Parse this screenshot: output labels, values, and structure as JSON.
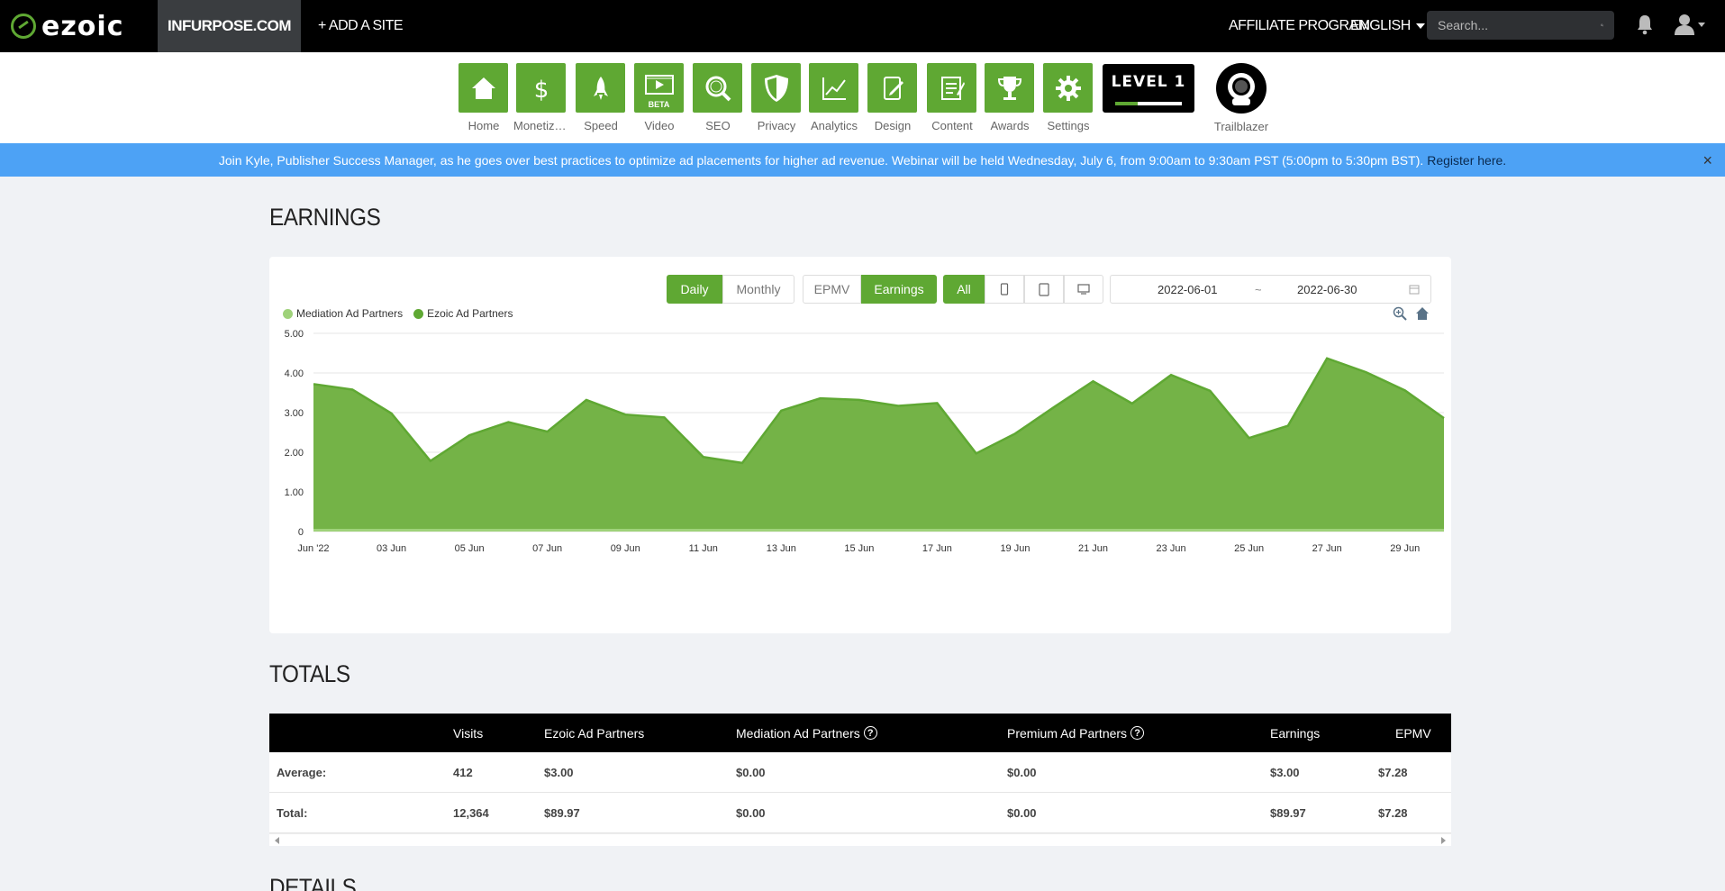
{
  "topbar": {
    "logo": "ezoic",
    "site": "INFURPOSE.COM",
    "add_site": "+ ADD A SITE",
    "affiliate": "AFFILIATE PROGRAM",
    "language": "ENGLISH",
    "search_placeholder": "Search..."
  },
  "nav": {
    "items": [
      {
        "label": "Home",
        "icon": "home-icon"
      },
      {
        "label": "Monetiza...",
        "icon": "dollar-icon"
      },
      {
        "label": "Speed",
        "icon": "rocket-icon"
      },
      {
        "label": "Video",
        "icon": "video-icon",
        "badge": "BETA"
      },
      {
        "label": "SEO",
        "icon": "magnifier-icon"
      },
      {
        "label": "Privacy",
        "icon": "shield-icon"
      },
      {
        "label": "Analytics",
        "icon": "chart-line-icon"
      },
      {
        "label": "Design",
        "icon": "design-icon"
      },
      {
        "label": "Content",
        "icon": "content-icon"
      },
      {
        "label": "Awards",
        "icon": "trophy-icon"
      },
      {
        "label": "Settings",
        "icon": "gear-icon"
      }
    ],
    "level": "LEVEL 1",
    "level_progress": 0.34,
    "trailblazer": "Trailblazer"
  },
  "banner": {
    "text": "Join Kyle, Publisher Success Manager, as he goes over best practices to optimize ad placements for higher ad revenue. Webinar will be held Wednesday, July 6, from 9:00am to 9:30am PST (5:00pm to 5:30pm BST).",
    "link": "Register here.",
    "close": "×"
  },
  "earnings": {
    "title": "EARNINGS",
    "period_buttons": [
      "Daily",
      "Monthly"
    ],
    "metric_buttons": [
      "EPMV",
      "Earnings"
    ],
    "device_all": "All",
    "date_start": "2022-06-01",
    "date_sep": "~",
    "date_end": "2022-06-30"
  },
  "chart_data": {
    "type": "area",
    "legend": [
      "Mediation Ad Partners",
      "Ezoic Ad Partners"
    ],
    "colors": {
      "mediation": "#9fd27a",
      "ezoic": "#5fa833",
      "fill": "#74b347"
    },
    "y_ticks": [
      "0",
      "1.00",
      "2.00",
      "3.00",
      "4.00",
      "5.00"
    ],
    "ylim": [
      0,
      5
    ],
    "x_tick_labels": [
      "Jun '22",
      "03 Jun",
      "05 Jun",
      "07 Jun",
      "09 Jun",
      "11 Jun",
      "13 Jun",
      "15 Jun",
      "17 Jun",
      "19 Jun",
      "21 Jun",
      "23 Jun",
      "25 Jun",
      "27 Jun",
      "29 Jun"
    ],
    "x": [
      "2022-06-01",
      "2022-06-02",
      "2022-06-03",
      "2022-06-04",
      "2022-06-05",
      "2022-06-06",
      "2022-06-07",
      "2022-06-08",
      "2022-06-09",
      "2022-06-10",
      "2022-06-11",
      "2022-06-12",
      "2022-06-13",
      "2022-06-14",
      "2022-06-15",
      "2022-06-16",
      "2022-06-17",
      "2022-06-18",
      "2022-06-19",
      "2022-06-20",
      "2022-06-21",
      "2022-06-22",
      "2022-06-23",
      "2022-06-24",
      "2022-06-25",
      "2022-06-26",
      "2022-06-27",
      "2022-06-28",
      "2022-06-29",
      "2022-06-30"
    ],
    "series": [
      {
        "name": "Mediation Ad Partners",
        "values": [
          0,
          0,
          0,
          0,
          0,
          0,
          0,
          0,
          0,
          0,
          0,
          0,
          0,
          0,
          0,
          0,
          0,
          0,
          0,
          0,
          0,
          0,
          0,
          0,
          0,
          0,
          0,
          0,
          0,
          0
        ]
      },
      {
        "name": "Ezoic Ad Partners",
        "values": [
          3.72,
          3.58,
          2.98,
          1.78,
          2.43,
          2.76,
          2.52,
          3.32,
          2.95,
          2.88,
          1.88,
          1.73,
          3.05,
          3.36,
          3.32,
          3.17,
          3.24,
          1.97,
          2.47,
          3.14,
          3.79,
          3.23,
          3.95,
          3.55,
          2.36,
          2.67,
          4.37,
          4.02,
          3.56,
          2.86
        ]
      }
    ]
  },
  "totals": {
    "title": "TOTALS",
    "headers": [
      "Visits",
      "Ezoic Ad Partners",
      "Mediation Ad Partners",
      "Premium Ad Partners",
      "Earnings",
      "EPMV"
    ],
    "rows": [
      {
        "label": "Average:",
        "cells": [
          "412",
          "$3.00",
          "$0.00",
          "$0.00",
          "$3.00",
          "$7.28"
        ]
      },
      {
        "label": "Total:",
        "cells": [
          "12,364",
          "$89.97",
          "$0.00",
          "$0.00",
          "$89.97",
          "$7.28"
        ]
      }
    ]
  },
  "details": {
    "title": "DETAILS"
  }
}
